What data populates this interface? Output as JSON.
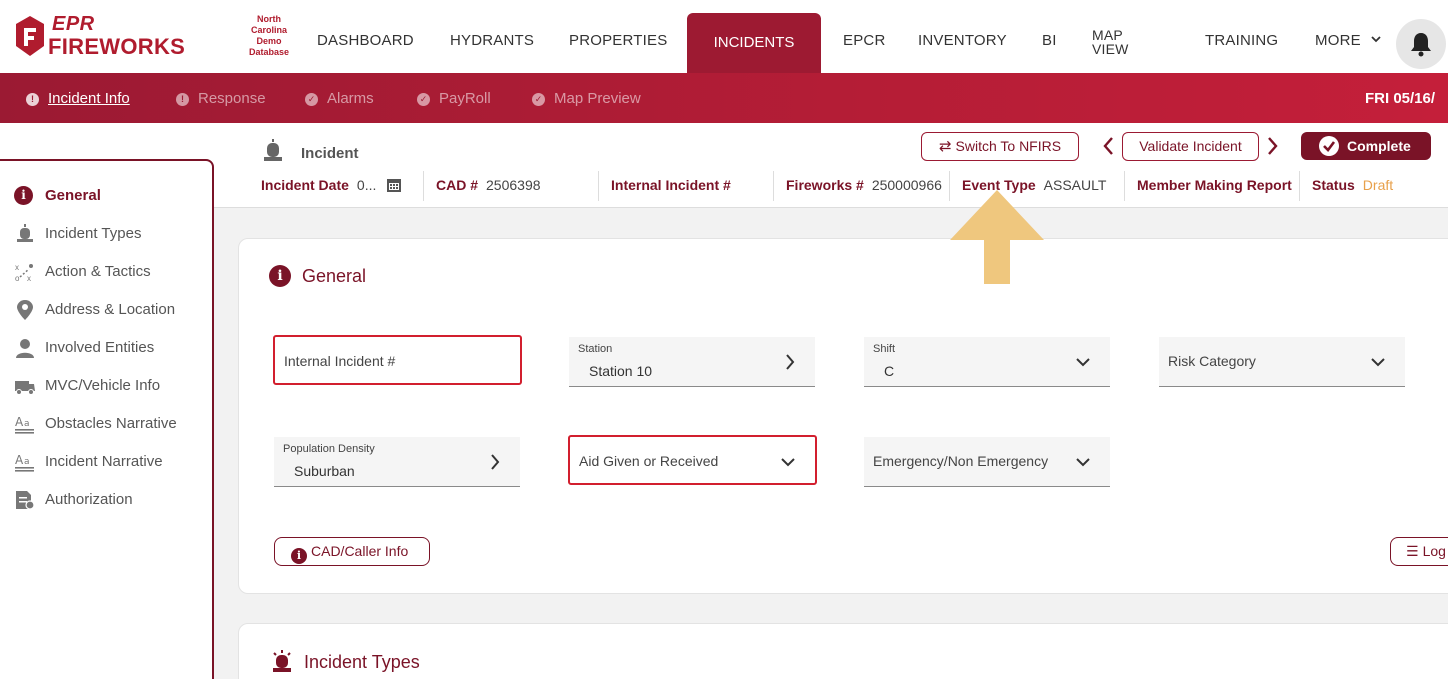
{
  "brand": {
    "epr": "EPR",
    "fireworks": "FIREWORKS",
    "demo_line1": "North",
    "demo_line2": "Carolina",
    "demo_line3": "Demo",
    "demo_line4": "Database"
  },
  "nav": {
    "dashboard": "DASHBOARD",
    "hydrants": "HYDRANTS",
    "properties": "PROPERTIES",
    "incidents": "INCIDENTS",
    "epcr": "EPCR",
    "inventory": "INVENTORY",
    "bi": "BI",
    "map_view_1": "MAP",
    "map_view_2": "VIEW",
    "training": "TRAINING",
    "more": "MORE"
  },
  "subnav": {
    "incident_info": "Incident Info",
    "response": "Response",
    "alarms": "Alarms",
    "payroll": "PayRoll",
    "map_preview": "Map Preview",
    "date": "FRI  05/16/"
  },
  "header": {
    "title": "Incident",
    "switch_nfirs": "Switch To NFIRS",
    "validate": "Validate Incident",
    "complete": "Complete",
    "incident_date_label": "Incident Date",
    "incident_date_value": "0...",
    "cad_label": "CAD #",
    "cad_value": "2506398",
    "internal_label": "Internal Incident #",
    "fireworks_label": "Fireworks #",
    "fireworks_value": "250000966",
    "event_type_label": "Event Type",
    "event_type_value": "ASSAULT",
    "member_label": "Member Making Report",
    "status_label": "Status",
    "status_value": "Draft"
  },
  "sidebar": {
    "items": [
      {
        "label": "General"
      },
      {
        "label": "Incident Types"
      },
      {
        "label": "Action & Tactics"
      },
      {
        "label": "Address & Location"
      },
      {
        "label": "Involved Entities"
      },
      {
        "label": "MVC/Vehicle Info"
      },
      {
        "label": "Obstacles Narrative"
      },
      {
        "label": "Incident Narrative"
      },
      {
        "label": "Authorization"
      }
    ]
  },
  "general": {
    "title": "General",
    "internal_incident_placeholder": "Internal Incident #",
    "station_label": "Station",
    "station_value": "Station 10",
    "shift_label": "Shift",
    "shift_value": "C",
    "risk_placeholder": "Risk Category",
    "pop_label": "Population Density",
    "pop_value": "Suburban",
    "aid_placeholder": "Aid Given or Received",
    "emergency_placeholder": "Emergency/Non Emergency",
    "cad_caller_btn": "CAD/Caller Info",
    "log_btn": "Log"
  },
  "incident_types": {
    "title": "Incident Types"
  },
  "colors": {
    "brand": "#9b1a33",
    "dark_brand": "#7a1327",
    "error": "#d21f2e",
    "draft": "#e8a04a",
    "annotation_arrow": "#efc77e"
  }
}
